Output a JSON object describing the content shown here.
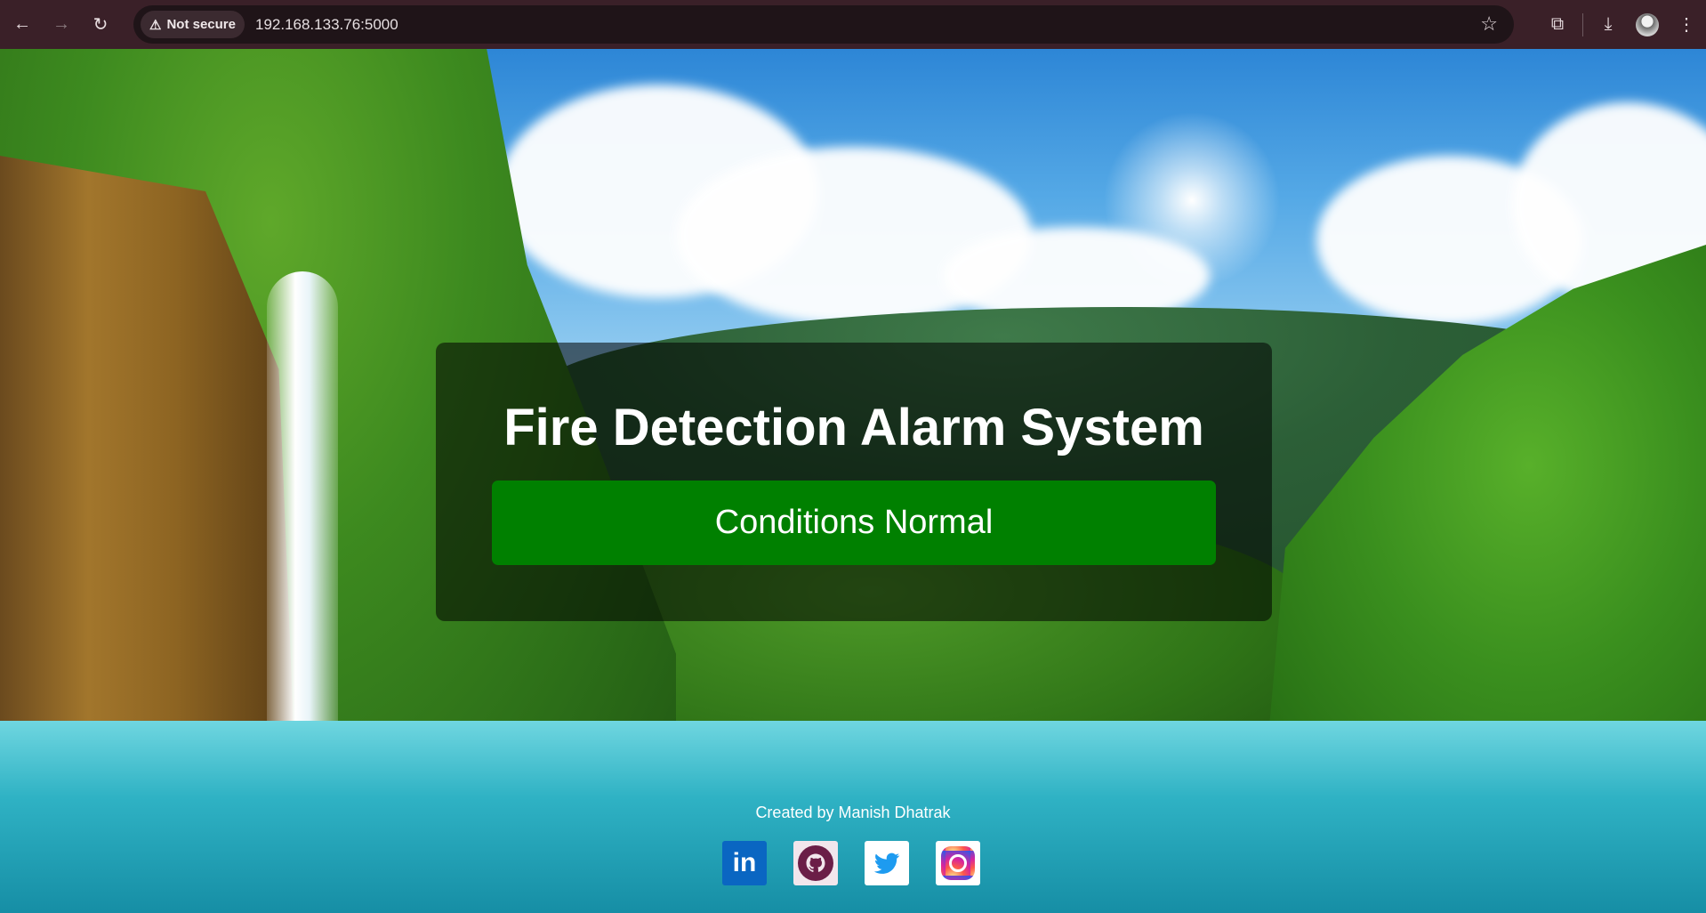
{
  "browser": {
    "security_label": "Not secure",
    "url": "192.168.133.76:5000"
  },
  "page": {
    "title": "Fire Detection Alarm System",
    "status": "Conditions Normal",
    "status_color": "#008000",
    "credit": "Created by Manish Dhatrak",
    "socials": [
      {
        "name": "LinkedIn",
        "icon": "linkedin-icon"
      },
      {
        "name": "GitHub",
        "icon": "github-icon"
      },
      {
        "name": "Twitter",
        "icon": "twitter-icon"
      },
      {
        "name": "Instagram",
        "icon": "instagram-icon"
      }
    ]
  },
  "colors": {
    "browser_bar": "#3a2028",
    "overlay": "rgba(0,0,0,0.55)"
  }
}
